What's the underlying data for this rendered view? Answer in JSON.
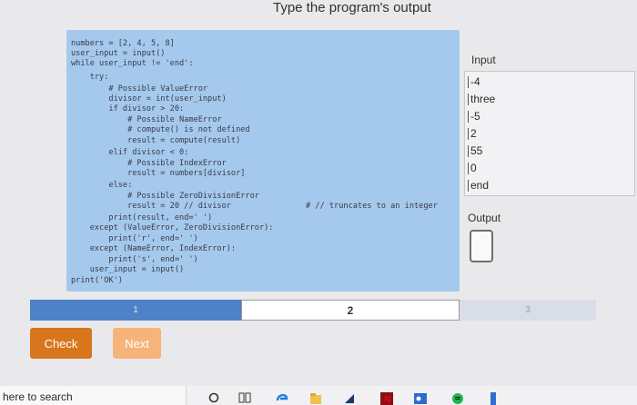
{
  "header": {
    "title": "Type the program's output"
  },
  "code": {
    "lines": [
      "numbers = [2, 4, 5, 8]",
      "user_input = input()",
      "while user_input != 'end':",
      "    try:",
      "        # Possible ValueError",
      "        divisor = int(user_input)",
      "        if divisor > 20:",
      "            # Possible NameError",
      "            # compute() is not defined",
      "            result = compute(result)",
      "        elif divisor < 0:",
      "            # Possible IndexError",
      "            result = numbers[divisor]",
      "        else:",
      "            # Possible ZeroDivisionError",
      "            result = 20 // divisor",
      "        print(result, end=' ')",
      "    except (ValueError, ZeroDivisionError):",
      "        print('r', end=' ')",
      "    except (NameError, IndexError):",
      "        print('s', end=' ')",
      "    user_input = input()",
      "print('OK')"
    ],
    "side_comment": "# // truncates to an integer"
  },
  "input_panel": {
    "label": "Input",
    "values": [
      "-4",
      "three",
      "-5",
      "2",
      "55",
      "0",
      "end"
    ]
  },
  "output_panel": {
    "label": "Output",
    "answer": ""
  },
  "progress": {
    "steps": [
      "1",
      "2",
      "3"
    ],
    "current": "2"
  },
  "actions": {
    "check_label": "Check",
    "next_label": "Next"
  },
  "taskbar": {
    "search_text": "here to search"
  },
  "colors": {
    "code_bg": "#a4c9ec",
    "progress_blue": "#4f81c8",
    "check_orange": "#d7761c",
    "next_orange": "#f6b47a"
  }
}
